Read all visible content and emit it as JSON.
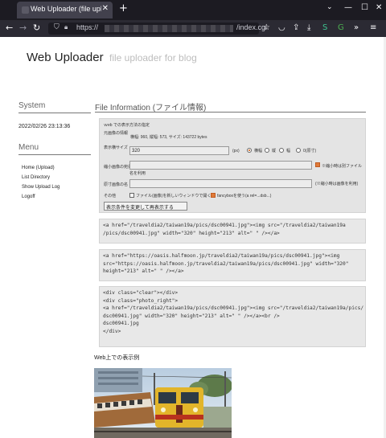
{
  "browser": {
    "tab_title": "Web Uploader (file uplo...",
    "url_prefix": "https://",
    "url_path": "/index.cgi"
  },
  "header": {
    "title": "Web Uploader",
    "subtitle": "file uploader for blog"
  },
  "sidebar": {
    "system_heading": "System",
    "datetime": "2022/02/26 23:13:36",
    "menu_heading": "Menu",
    "menu_items": [
      {
        "label": "Home (Upload)"
      },
      {
        "label": "List Directory"
      },
      {
        "label": "Show Upload Log"
      },
      {
        "label": "Logoff"
      }
    ]
  },
  "main": {
    "heading": "File Information (ファイル情報)",
    "form": {
      "intro": "ｗeb での表示方法の指定",
      "file_info_label": "元画像の情報",
      "file_info_value": "横幅: 960, 縦幅: 573, サイズ: 143722 bytes",
      "display_size_label": "表示横サイズ",
      "display_size_value": "320",
      "display_size_unit": "(px)",
      "radio_options": [
        "横幅",
        "縦",
        "幅",
        "0(原寸)"
      ],
      "selected_radio": 0,
      "thumb_link_label": "縮小画像の宛先",
      "thumb_link_note": "※縮小時は別ファイル",
      "thumb_link_note2": "名を利用",
      "original_link_label": "原寸画像の名",
      "original_link_note": "(※縮小時は画像を利用)",
      "other_label": "その他",
      "checkbox1_label": "ファイル(画像)を新しいウィンドウで開く",
      "checkbox1_checked": false,
      "checkbox2_label": "fancyboxを使う(a rel=...dsb...)",
      "checkbox2_checked": true,
      "submit_label": "表示条件を変更して再表示する"
    },
    "code_blocks": [
      "<a href=\"/traveldia2/taiwan19a/pics/dsc00941.jpg\"><img src=\"/traveldia2/taiwan19a\n/pics/dsc00941.jpg\" width=\"320\" height=\"213\" alt=\" \" /></a>",
      "<a href=\"https://oasis.halfmoon.jp/traveldia2/taiwan19a/pics/dsc00941.jpg\"><img\nsrc=\"https://oasis.halfmoon.jp/traveldia2/taiwan19a/pics/dsc00941.jpg\" width=\"320\"\nheight=\"213\" alt=\" \" /></a>",
      "<div class=\"clear\"></div>\n<div class=\"photo_right\">\n<a href=\"/traveldia2/taiwan19a/pics/dsc00941.jpg\"><img src=\"/traveldia2/taiwan19a/pics/\ndsc00941.jpg\" width=\"320\" height=\"213\" alt=\" \" /></a><br />\ndsc00941.jpg\n</div>"
    ],
    "sample_label": "Web上での表示例"
  },
  "colors": {
    "chrome_dark": "#1c1b22",
    "toolbar": "#2b2a33",
    "accent_orange": "#e07b39",
    "muted_text": "#bdbdbd"
  }
}
